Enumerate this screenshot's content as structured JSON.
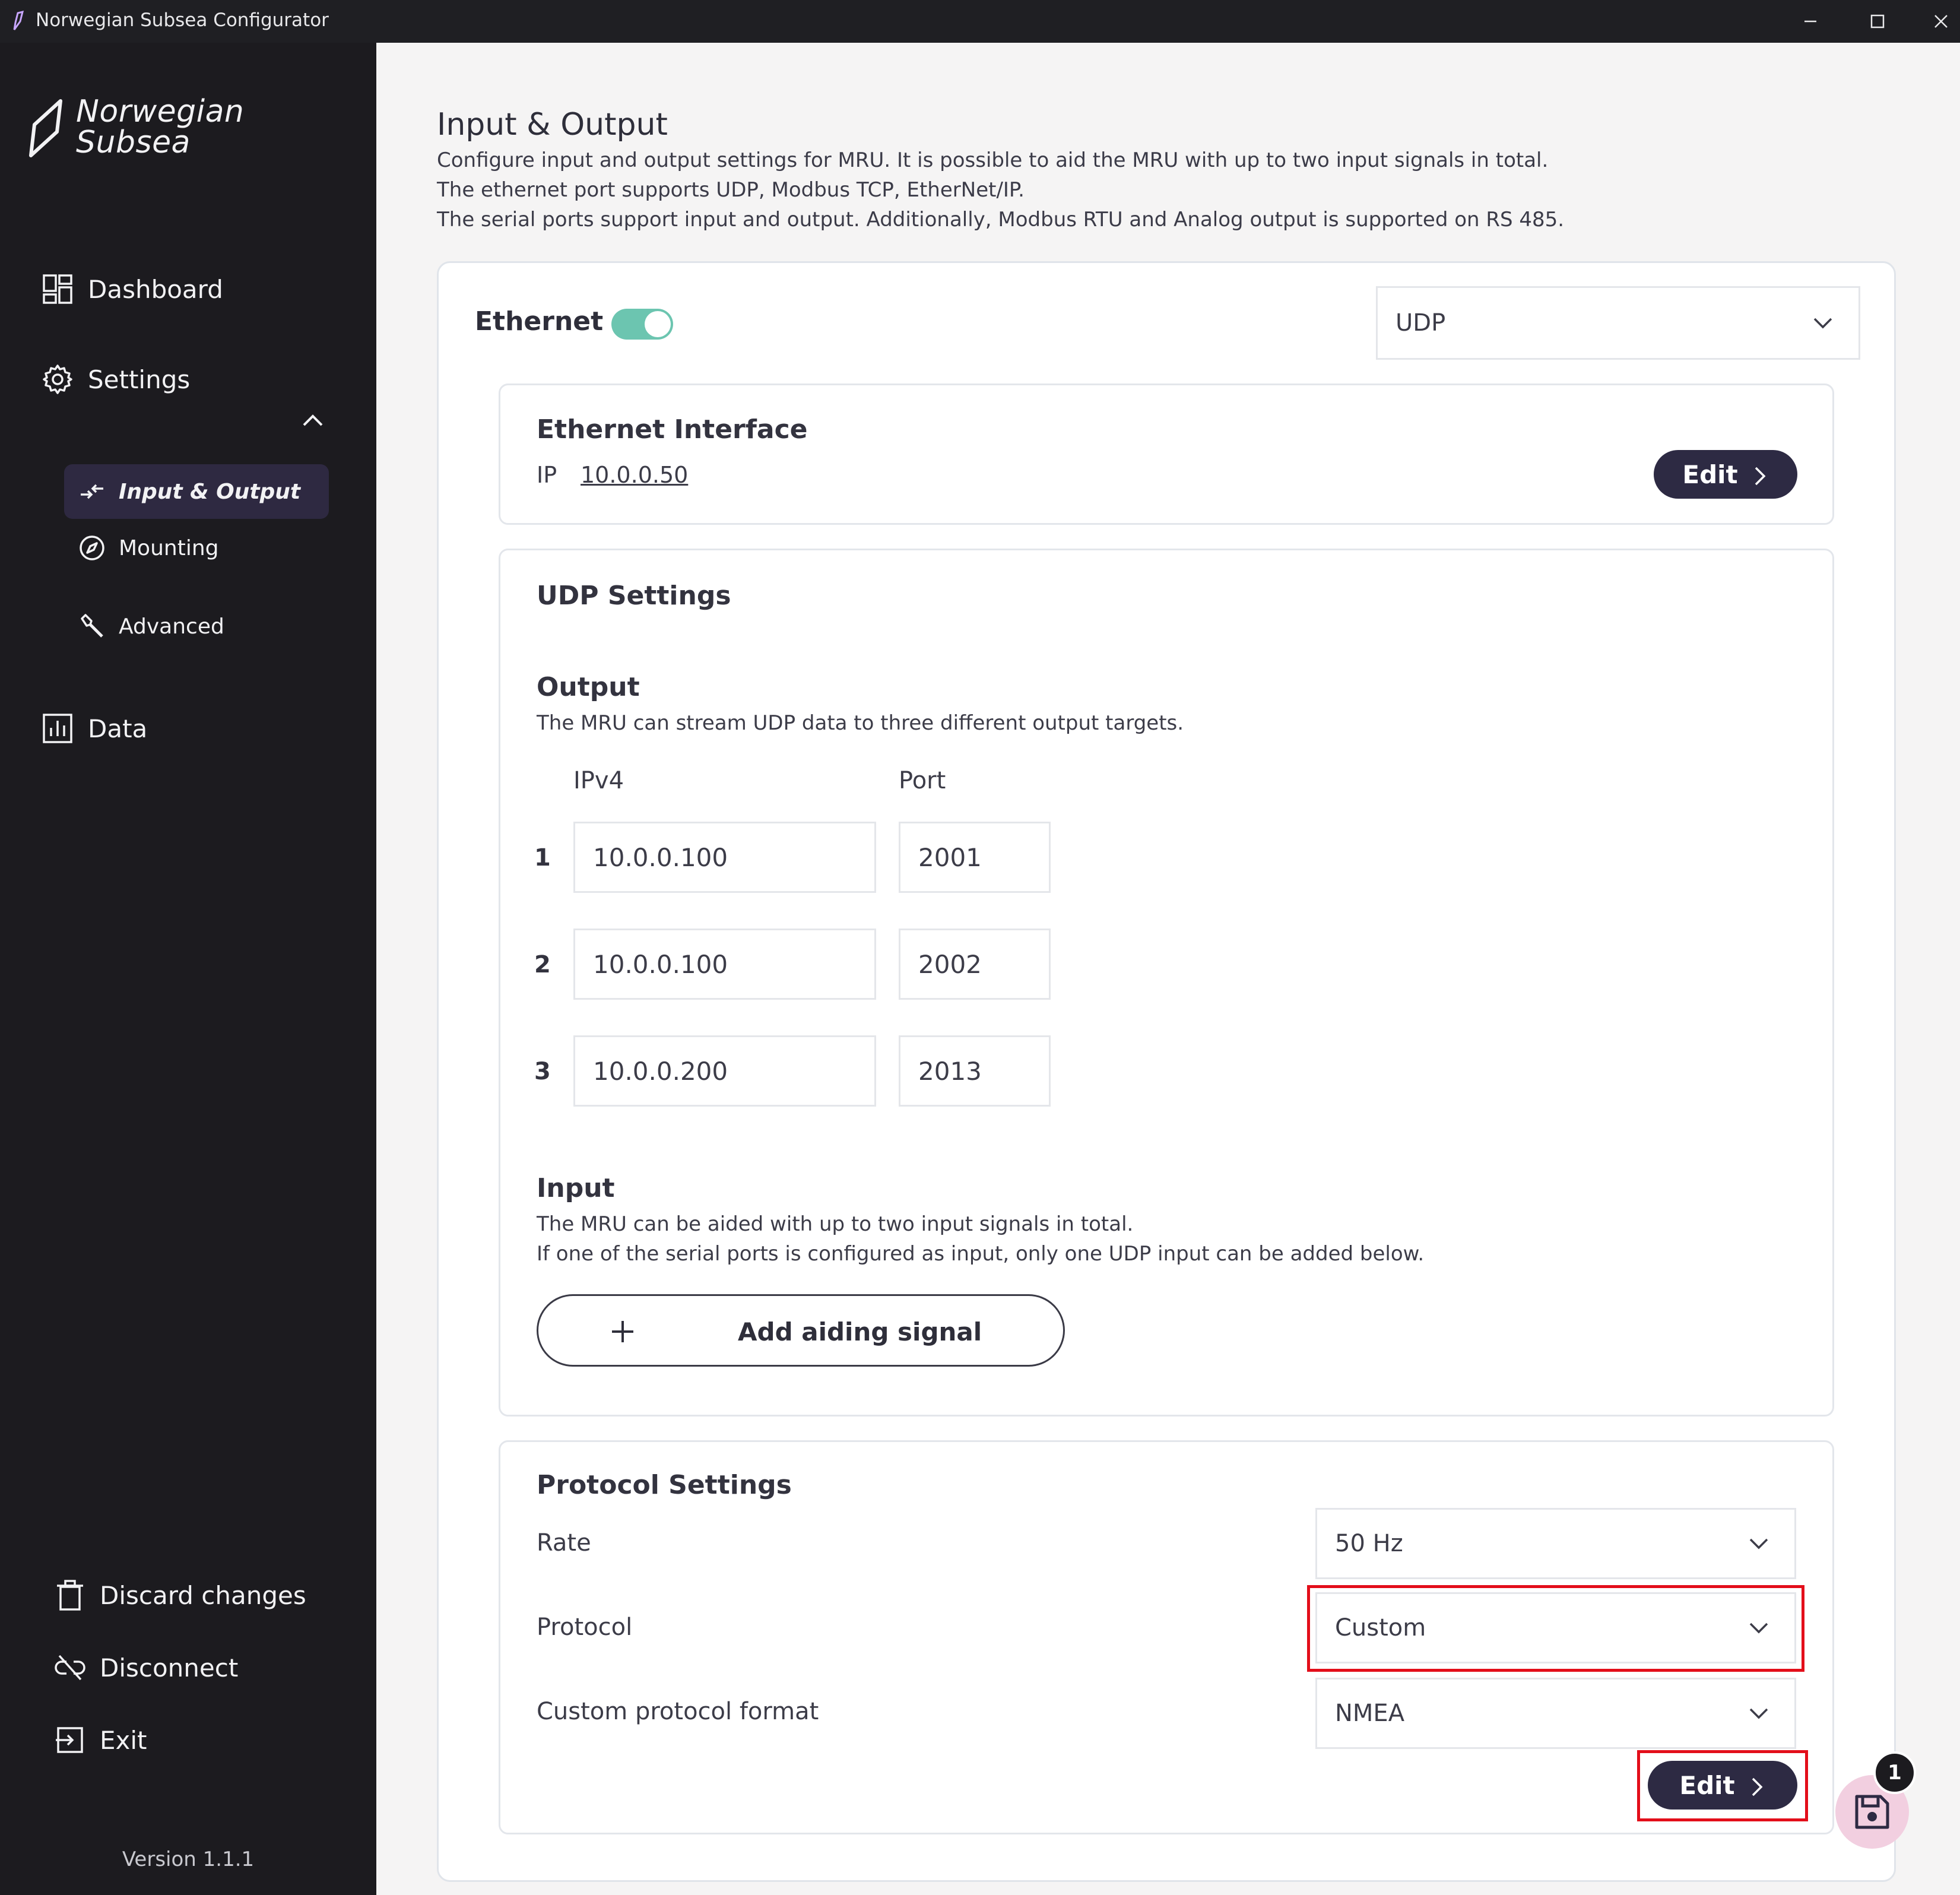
{
  "window": {
    "title": "Norwegian Subsea Configurator"
  },
  "sidebar": {
    "logo_line1": "Norwegian",
    "logo_line2": "Subsea",
    "dashboard": "Dashboard",
    "settings": "Settings",
    "sub_items": {
      "input_output": "Input & Output",
      "mounting": "Mounting",
      "advanced": "Advanced"
    },
    "data": "Data",
    "discard": "Discard changes",
    "disconnect": "Disconnect",
    "exit": "Exit",
    "version": "Version 1.1.1"
  },
  "page": {
    "title": "Input & Output",
    "desc1": "Configure input and output settings for MRU. It is possible to aid the MRU with up to two input signals in total.",
    "desc2": "The ethernet port supports UDP, Modbus TCP, EtherNet/IP.",
    "desc3": "The serial ports support input and output. Additionally, Modbus RTU and Analog output is supported on RS 485."
  },
  "ethernet": {
    "label": "Ethernet",
    "enabled": true,
    "protocol_select": "UDP"
  },
  "ethernet_interface": {
    "title": "Ethernet Interface",
    "ip_label": "IP",
    "ip_value": "10.0.0.50",
    "edit_label": "Edit"
  },
  "udp_settings": {
    "title": "UDP Settings",
    "output_title": "Output",
    "output_desc": "The MRU can stream UDP data to three different output targets.",
    "col_ipv4": "IPv4",
    "col_port": "Port",
    "rows": [
      {
        "num": "1",
        "ip": "10.0.0.100",
        "port": "2001"
      },
      {
        "num": "2",
        "ip": "10.0.0.100",
        "port": "2002"
      },
      {
        "num": "3",
        "ip": "10.0.0.200",
        "port": "2013"
      }
    ],
    "input_title": "Input",
    "input_desc1": "The MRU can be aided with up to two input signals in total.",
    "input_desc2": "If one of the serial ports is configured as input, only one UDP input can be added below.",
    "add_label": "Add aiding signal"
  },
  "protocol_settings": {
    "title": "Protocol Settings",
    "rate_label": "Rate",
    "rate_value": "50 Hz",
    "protocol_label": "Protocol",
    "protocol_value": "Custom",
    "format_label": "Custom protocol format",
    "format_value": "NMEA",
    "edit_label": "Edit"
  },
  "save": {
    "badge_count": "1"
  },
  "colors": {
    "sidebar_bg": "#1c1b1f",
    "active_bg": "#2e2941",
    "toggle_on": "#6cc5b0",
    "button_bg": "#2d2a43",
    "highlight": "#e30e1a"
  }
}
